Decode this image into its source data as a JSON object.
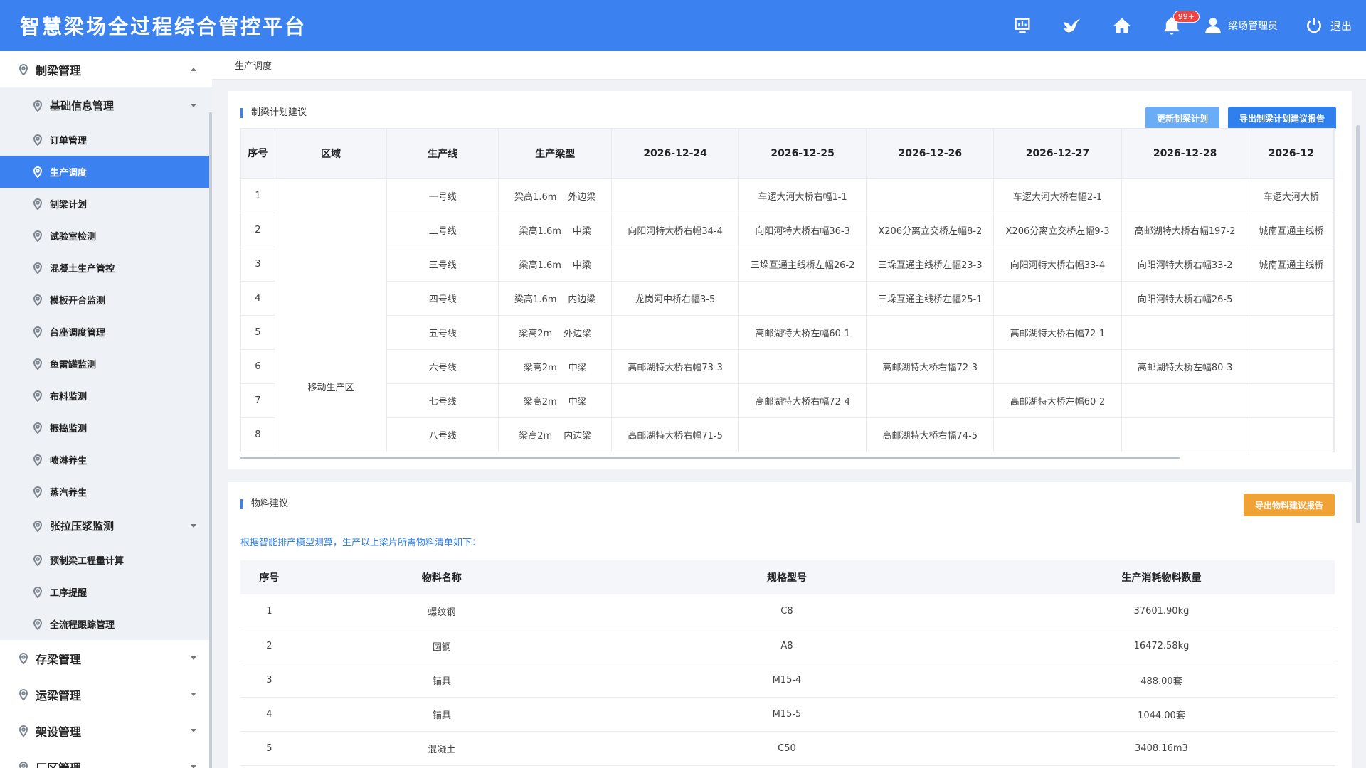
{
  "header": {
    "title": "智慧梁场全过程综合管控平台",
    "badge": "99+",
    "user": "梁场管理员",
    "logout": "退出"
  },
  "sidebar": {
    "group_main": "制梁管理",
    "sub": [
      {
        "label": "基础信息管理",
        "big": true,
        "caret": true
      },
      {
        "label": "订单管理"
      },
      {
        "label": "生产调度",
        "active": true
      },
      {
        "label": "制梁计划"
      },
      {
        "label": "试验室检测"
      },
      {
        "label": "混凝土生产管控"
      },
      {
        "label": "模板开合监测"
      },
      {
        "label": "台座调度管理"
      },
      {
        "label": "鱼雷罐监测"
      },
      {
        "label": "布料监测"
      },
      {
        "label": "振捣监测"
      },
      {
        "label": "喷淋养生"
      },
      {
        "label": "蒸汽养生"
      },
      {
        "label": "张拉压浆监测",
        "big": true,
        "caret": true
      },
      {
        "label": "预制梁工程量计算"
      },
      {
        "label": "工序提醒"
      },
      {
        "label": "全流程跟踪管理"
      }
    ],
    "groups": [
      "存梁管理",
      "运梁管理",
      "架设管理",
      "厂区管理"
    ]
  },
  "breadcrumb": "生产调度",
  "plan": {
    "title": "制梁计划建议",
    "btn_update": "更新制梁计划",
    "btn_export": "导出制梁计划建议报告",
    "headers": [
      "序号",
      "区域",
      "生产线",
      "生产梁型",
      "2026-12-24",
      "2026-12-25",
      "2026-12-26",
      "2026-12-27",
      "2026-12-28",
      "2026-12"
    ],
    "area": "移动生产区",
    "rows": [
      {
        "no": "1",
        "line": "一号线",
        "h": "梁高1.6m",
        "t": "外边梁",
        "d": [
          "",
          "车逻大河大桥右幅1-1",
          "",
          "车逻大河大桥右幅2-1",
          "",
          "车逻大河大桥"
        ]
      },
      {
        "no": "2",
        "line": "二号线",
        "h": "梁高1.6m",
        "t": "中梁",
        "d": [
          "向阳河特大桥右幅34-4",
          "向阳河特大桥右幅36-3",
          "X206分离立交桥左幅8-2",
          "X206分离立交桥左幅9-3",
          "高邮湖特大桥右幅197-2",
          "城南互通主线桥"
        ]
      },
      {
        "no": "3",
        "line": "三号线",
        "h": "梁高1.6m",
        "t": "中梁",
        "d": [
          "",
          "三垛互通主线桥左幅26-2",
          "三垛互通主线桥左幅23-3",
          "向阳河特大桥右幅33-4",
          "向阳河特大桥右幅33-2",
          "城南互通主线桥"
        ]
      },
      {
        "no": "4",
        "line": "四号线",
        "h": "梁高1.6m",
        "t": "内边梁",
        "d": [
          "龙岗河中桥右幅3-5",
          "",
          "三垛互通主线桥左幅25-1",
          "",
          "向阳河特大桥右幅26-5",
          ""
        ]
      },
      {
        "no": "5",
        "line": "五号线",
        "h": "梁高2m",
        "t": "外边梁",
        "d": [
          "",
          "高邮湖特大桥左幅60-1",
          "",
          "高邮湖特大桥右幅72-1",
          "",
          ""
        ]
      },
      {
        "no": "6",
        "line": "六号线",
        "h": "梁高2m",
        "t": "中梁",
        "d": [
          "高邮湖特大桥右幅73-3",
          "",
          "高邮湖特大桥右幅72-3",
          "",
          "高邮湖特大桥左幅80-3",
          ""
        ]
      },
      {
        "no": "7",
        "line": "七号线",
        "h": "梁高2m",
        "t": "中梁",
        "d": [
          "",
          "高邮湖特大桥右幅72-4",
          "",
          "高邮湖特大桥左幅60-2",
          "",
          ""
        ]
      },
      {
        "no": "8",
        "line": "八号线",
        "h": "梁高2m",
        "t": "内边梁",
        "d": [
          "高邮湖特大桥右幅71-5",
          "",
          "高邮湖特大桥右幅74-5",
          "",
          "",
          ""
        ]
      }
    ]
  },
  "material": {
    "title": "物料建议",
    "btn_export": "导出物料建议报告",
    "note": "根据智能排产模型测算，生产以上梁片所需物料清单如下：",
    "headers": [
      "序号",
      "物料名称",
      "规格型号",
      "生产消耗物料数量"
    ],
    "rows": [
      [
        "1",
        "螺纹钢",
        "C8",
        "37601.90kg"
      ],
      [
        "2",
        "圆钢",
        "A8",
        "16472.58kg"
      ],
      [
        "3",
        "锚具",
        "M15-4",
        "488.00套"
      ],
      [
        "4",
        "锚具",
        "M15-5",
        "1044.00套"
      ],
      [
        "5",
        "混凝土",
        "C50",
        "3408.16m3"
      ]
    ]
  }
}
